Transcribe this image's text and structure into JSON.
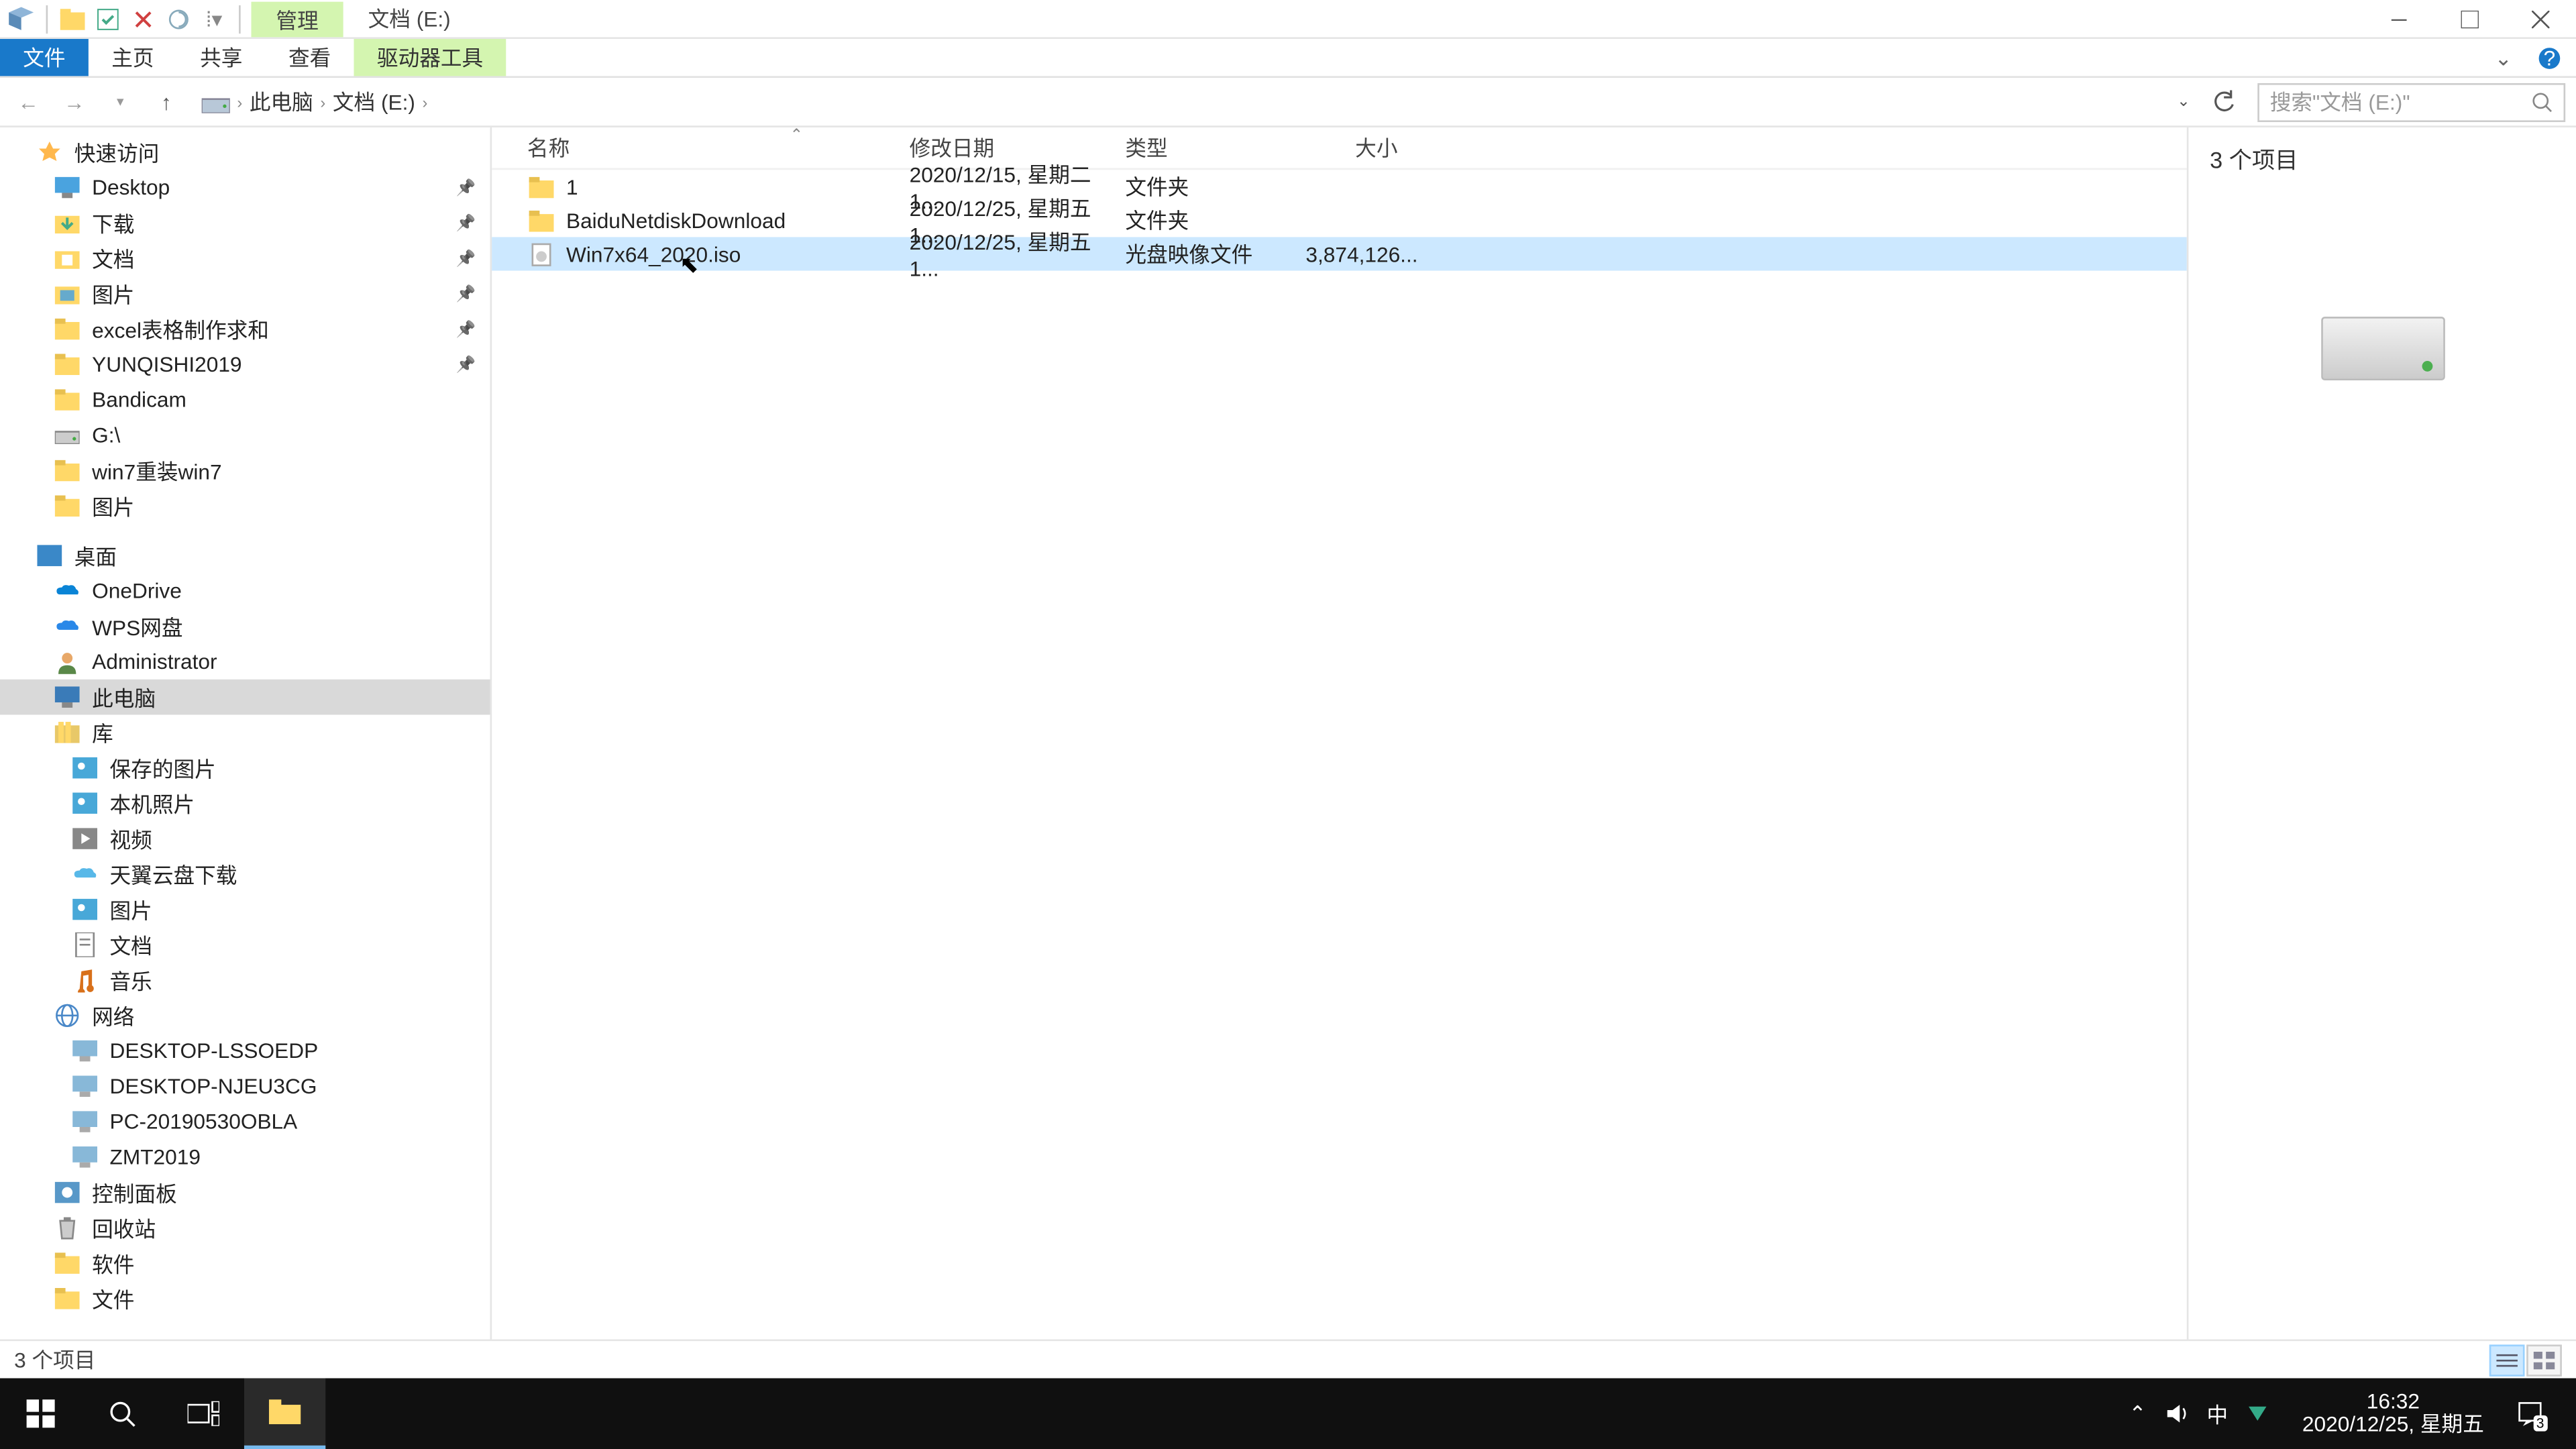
{
  "title": "文档 (E:)",
  "ctx_tab": "管理",
  "ribbon": {
    "file": "文件",
    "home": "主页",
    "share": "共享",
    "view": "查看",
    "drive": "驱动器工具"
  },
  "breadcrumb": {
    "root": "此电脑",
    "drive": "文档 (E:)"
  },
  "search_placeholder": "搜索\"文档 (E:)\"",
  "columns": {
    "name": "名称",
    "date": "修改日期",
    "type": "类型",
    "size": "大小"
  },
  "files": [
    {
      "name": "1",
      "date": "2020/12/15, 星期二 1...",
      "type": "文件夹",
      "size": "",
      "icon": "folder",
      "sel": false
    },
    {
      "name": "BaiduNetdiskDownload",
      "date": "2020/12/25, 星期五 1...",
      "type": "文件夹",
      "size": "",
      "icon": "folder",
      "sel": false
    },
    {
      "name": "Win7x64_2020.iso",
      "date": "2020/12/25, 星期五 1...",
      "type": "光盘映像文件",
      "size": "3,874,126...",
      "icon": "iso",
      "sel": true
    }
  ],
  "nav": {
    "quick": "快速访问",
    "quick_items": [
      {
        "l": "Desktop",
        "i": "desktop",
        "pin": true
      },
      {
        "l": "下载",
        "i": "downloads",
        "pin": true
      },
      {
        "l": "文档",
        "i": "documents",
        "pin": true
      },
      {
        "l": "图片",
        "i": "pictures",
        "pin": true
      },
      {
        "l": "excel表格制作求和",
        "i": "folder",
        "pin": true
      },
      {
        "l": "YUNQISHI2019",
        "i": "folder",
        "pin": true
      },
      {
        "l": "Bandicam",
        "i": "folder",
        "pin": false
      },
      {
        "l": "G:\\",
        "i": "drive",
        "pin": false
      },
      {
        "l": "win7重装win7",
        "i": "folder",
        "pin": false
      },
      {
        "l": "图片",
        "i": "folder",
        "pin": false
      }
    ],
    "desktop": "桌面",
    "desktop_items": [
      {
        "l": "OneDrive",
        "i": "onedrive"
      },
      {
        "l": "WPS网盘",
        "i": "wps"
      },
      {
        "l": "Administrator",
        "i": "user"
      },
      {
        "l": "此电脑",
        "i": "thispc",
        "sel": true
      },
      {
        "l": "库",
        "i": "library"
      }
    ],
    "lib_items": [
      {
        "l": "保存的图片",
        "i": "picLib"
      },
      {
        "l": "本机照片",
        "i": "picLib"
      },
      {
        "l": "视频",
        "i": "video"
      },
      {
        "l": "天翼云盘下载",
        "i": "cloud"
      },
      {
        "l": "图片",
        "i": "picLib"
      },
      {
        "l": "文档",
        "i": "docLib"
      },
      {
        "l": "音乐",
        "i": "music"
      }
    ],
    "network": "网络",
    "net_items": [
      {
        "l": "DESKTOP-LSSOEDP",
        "i": "pc"
      },
      {
        "l": "DESKTOP-NJEU3CG",
        "i": "pc"
      },
      {
        "l": "PC-20190530OBLA",
        "i": "pc"
      },
      {
        "l": "ZMT2019",
        "i": "pc"
      }
    ],
    "cp": "控制面板",
    "recycle": "回收站",
    "soft": "软件",
    "wenjian": "文件"
  },
  "details": {
    "count": "3 个项目"
  },
  "status": {
    "text": "3 个项目"
  },
  "clock": {
    "time": "16:32",
    "date": "2020/12/25, 星期五"
  },
  "ime": "中",
  "notif_badge": "3"
}
